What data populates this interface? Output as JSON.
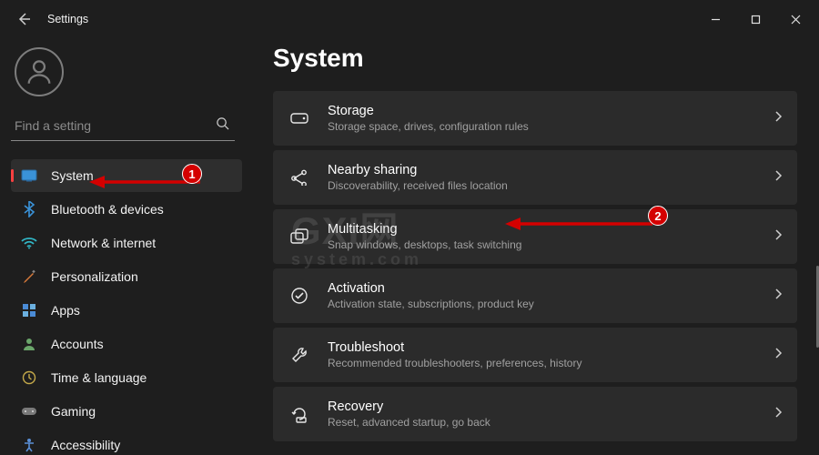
{
  "titlebar": {
    "title": "Settings"
  },
  "search": {
    "placeholder": "Find a setting"
  },
  "sidebar": {
    "items": [
      {
        "label": "System"
      },
      {
        "label": "Bluetooth & devices"
      },
      {
        "label": "Network & internet"
      },
      {
        "label": "Personalization"
      },
      {
        "label": "Apps"
      },
      {
        "label": "Accounts"
      },
      {
        "label": "Time & language"
      },
      {
        "label": "Gaming"
      },
      {
        "label": "Accessibility"
      }
    ]
  },
  "page": {
    "heading": "System"
  },
  "cards": [
    {
      "title": "Storage",
      "sub": "Storage space, drives, configuration rules"
    },
    {
      "title": "Nearby sharing",
      "sub": "Discoverability, received files location"
    },
    {
      "title": "Multitasking",
      "sub": "Snap windows, desktops, task switching"
    },
    {
      "title": "Activation",
      "sub": "Activation state, subscriptions, product key"
    },
    {
      "title": "Troubleshoot",
      "sub": "Recommended troubleshooters, preferences, history"
    },
    {
      "title": "Recovery",
      "sub": "Reset, advanced startup, go back"
    }
  ],
  "annotations": {
    "badge1": "1",
    "badge2": "2"
  },
  "watermark": {
    "main": "GXI网",
    "sub": "system.com"
  }
}
